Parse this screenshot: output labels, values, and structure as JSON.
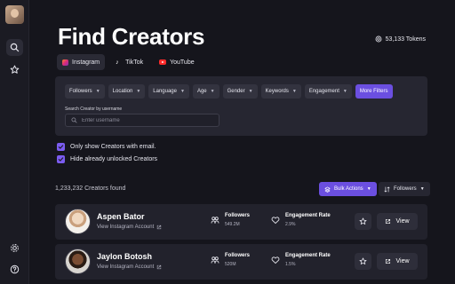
{
  "header": {
    "title": "Find Creators",
    "tokens": "53,133 Tokens"
  },
  "tabs": [
    {
      "label": "Instagram",
      "icon": "instagram-icon",
      "active": true
    },
    {
      "label": "TikTok",
      "icon": "tiktok-icon",
      "active": false
    },
    {
      "label": "YouTube",
      "icon": "youtube-icon",
      "active": false
    }
  ],
  "filters": {
    "items": [
      "Followers",
      "Location",
      "Language",
      "Age",
      "Gender",
      "Keywords",
      "Engagement"
    ],
    "more_label": "More Filters",
    "search_label": "Search Creator by username",
    "search_placeholder": "Enter username",
    "search_value": ""
  },
  "options": {
    "email_only": {
      "label": "Only show Creators with email.",
      "checked": true
    },
    "hide_unlocked": {
      "label": "Hide already unlocked Creators",
      "checked": true
    }
  },
  "results": {
    "count_text": "1,233,232 Creators found",
    "bulk_label": "Bulk Actions",
    "sort_label": "Followers"
  },
  "creators": [
    {
      "name": "Aspen Bator",
      "link_label": "View Instagram Account",
      "followers_label": "Followers",
      "followers_value": "549.2M",
      "engagement_label": "Engagement Rate",
      "engagement_value": "2.9%",
      "view_label": "View"
    },
    {
      "name": "Jaylon Botosh",
      "link_label": "View Instagram Account",
      "followers_label": "Followers",
      "followers_value": "520M",
      "engagement_label": "Engagement Rate",
      "engagement_value": "1.5%",
      "view_label": "View"
    }
  ],
  "colors": {
    "background": "#15151c",
    "panel": "#262631",
    "accent": "#6b4fe0",
    "checkbox": "#7b5cf0"
  }
}
